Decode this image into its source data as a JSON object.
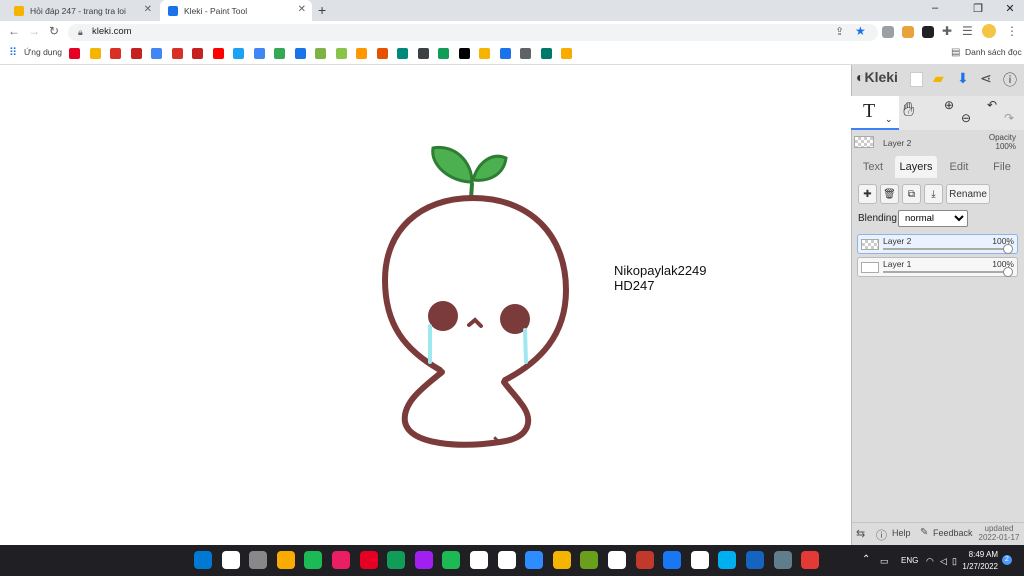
{
  "browser": {
    "tabs": [
      {
        "title": "Hỏi đáp 247 - trang tra loi",
        "favicon_color": "#f4b400"
      },
      {
        "title": "Kleki - Paint Tool",
        "favicon_color": "#1a73e8"
      }
    ],
    "url": "kleki.com",
    "apps_label": "Ứng dụng",
    "reading_list_label": "Danh sách đọc",
    "bookmark_colors": [
      "#e60023",
      "#f4b400",
      "#d93025",
      "#c5221f",
      "#4285f4",
      "#d93025",
      "#c5221f",
      "#ff0000",
      "#1da1f2",
      "#4285f4",
      "#34a853",
      "#1a73e8",
      "#7cb342",
      "#8bc34a",
      "#ff9800",
      "#e65100",
      "#00897b",
      "#3c4043",
      "#0f9d58",
      "#000000",
      "#f4b400",
      "#1a73e8",
      "#5f6368",
      "#00796b",
      "#f9ab00"
    ]
  },
  "kleki": {
    "logo": "Kleki",
    "tool_text_glyph": "T",
    "active_layer_name": "Layer 2",
    "opacity_label": "Opacity",
    "opacity_value": "100%",
    "tabs": [
      "Text",
      "Layers",
      "Edit",
      "File"
    ],
    "rename_label": "Rename",
    "blending_label": "Blending",
    "blending_value": "normal",
    "layers": [
      {
        "name": "Layer 2",
        "opacity": "100%"
      },
      {
        "name": "Layer 1",
        "opacity": "100%"
      }
    ],
    "help_label": "Help",
    "feedback_label": "Feedback",
    "updated_label": "updated",
    "updated_date": "2022-01-17"
  },
  "canvas": {
    "text_line1": "Nikopaylak2249",
    "text_line2": "HD247",
    "stroke_color": "#7b3b3b",
    "leaf_color": "#4caf50",
    "tear_color": "#9fe8f0"
  },
  "taskbar": {
    "icon_colors": [
      "#0078d4",
      "#ffffff",
      "#888888",
      "#f9ab00",
      "#1db954",
      "#e91e63",
      "#e60023",
      "#0f9d58",
      "#a020f0",
      "#1db954",
      "#ffffff",
      "#ffffff",
      "#2d8cff",
      "#f4b400",
      "#6a9f1b",
      "#ffffff",
      "#c0392b",
      "#1877f2",
      "#ffffff",
      "#00aff0",
      "#1565c0",
      "#607d8b",
      "#e53935"
    ],
    "lang": "ENG",
    "time": "8:49 AM",
    "date": "1/27/2022",
    "notification_count": "2"
  }
}
